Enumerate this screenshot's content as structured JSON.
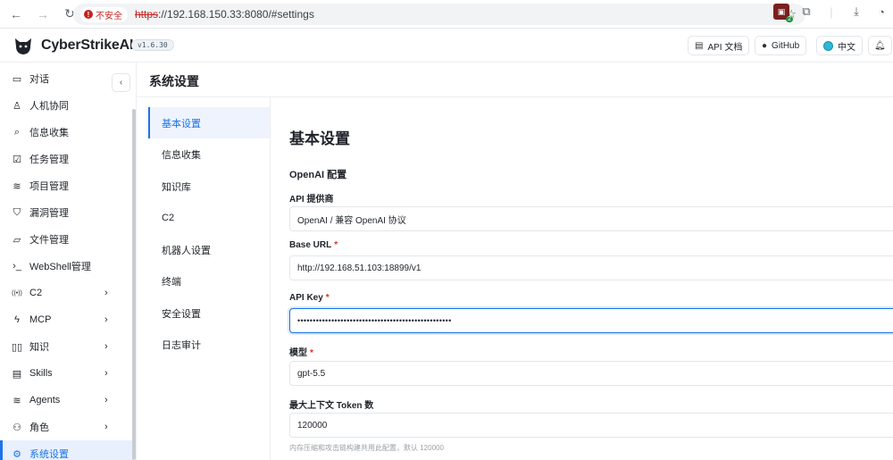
{
  "browser": {
    "security_warning": "不安全",
    "url_scheme": "https",
    "url_rest": "://192.168.150.33:8080/#settings",
    "extension_badge": "2"
  },
  "header": {
    "brand": "CyberStrikeAI",
    "version": "v1.6.30",
    "api_docs_label": "API 文档",
    "github_label": "GitHub",
    "language_label": "中文"
  },
  "sidebar": {
    "items": [
      {
        "label": "对话",
        "icon": "chat-icon",
        "glyph": "▭",
        "chevron": false,
        "active": false
      },
      {
        "label": "人机协同",
        "icon": "user-collab-icon",
        "glyph": "♙",
        "chevron": false,
        "active": false
      },
      {
        "label": "信息收集",
        "icon": "search-icon",
        "glyph": "⌕",
        "chevron": false,
        "active": false
      },
      {
        "label": "任务管理",
        "icon": "checklist-icon",
        "glyph": "☑",
        "chevron": false,
        "active": false
      },
      {
        "label": "项目管理",
        "icon": "layers-icon",
        "glyph": "≋",
        "chevron": false,
        "active": false
      },
      {
        "label": "漏洞管理",
        "icon": "shield-icon",
        "glyph": "⛉",
        "chevron": false,
        "active": false
      },
      {
        "label": "文件管理",
        "icon": "folder-icon",
        "glyph": "▱",
        "chevron": false,
        "active": false
      },
      {
        "label": "WebShell管理",
        "icon": "terminal-icon",
        "glyph": "›_",
        "chevron": false,
        "active": false
      },
      {
        "label": "C2",
        "icon": "broadcast-icon",
        "glyph": "((•))",
        "chevron": true,
        "active": false
      },
      {
        "label": "MCP",
        "icon": "lightning-icon",
        "glyph": "ϟ",
        "chevron": true,
        "active": false
      },
      {
        "label": "知识",
        "icon": "book-icon",
        "glyph": "▯▯",
        "chevron": true,
        "active": false
      },
      {
        "label": "Skills",
        "icon": "document-icon",
        "glyph": "▤",
        "chevron": true,
        "active": false
      },
      {
        "label": "Agents",
        "icon": "stack-icon",
        "glyph": "≋",
        "chevron": true,
        "active": false
      },
      {
        "label": "角色",
        "icon": "users-icon",
        "glyph": "⚇",
        "chevron": true,
        "active": false
      },
      {
        "label": "系统设置",
        "icon": "gear-icon",
        "glyph": "⚙",
        "chevron": false,
        "active": true
      }
    ]
  },
  "page": {
    "title": "系统设置"
  },
  "settings_nav": {
    "items": [
      {
        "label": "基本设置",
        "active": true
      },
      {
        "label": "信息收集",
        "active": false
      },
      {
        "label": "知识库",
        "active": false
      },
      {
        "label": "C2",
        "active": false
      },
      {
        "label": "机器人设置",
        "active": false
      },
      {
        "label": "终端",
        "active": false
      },
      {
        "label": "安全设置",
        "active": false
      },
      {
        "label": "日志审计",
        "active": false
      }
    ]
  },
  "form": {
    "section_title": "基本设置",
    "subsection_title": "OpenAI 配置",
    "provider_label": "API 提供商",
    "provider_value": "OpenAI / 兼容 OpenAI 协议",
    "base_url_label": "Base URL",
    "base_url_value": "http://192.168.51.103:18899/v1",
    "api_key_label": "API Key",
    "api_key_value": "••••••••••••••••••••••••••••••••••••••••••••••••••",
    "model_label": "模型",
    "model_value": "gpt-5.5",
    "max_tokens_label": "最大上下文 Token 数",
    "max_tokens_value": "120000",
    "max_tokens_hint": "内存压缩和攻击链构建共用此配置，默认 120000",
    "required_mark": "*"
  },
  "colors": {
    "accent": "#1a73e8",
    "required": "#d93025",
    "warning": "#c5221f"
  }
}
